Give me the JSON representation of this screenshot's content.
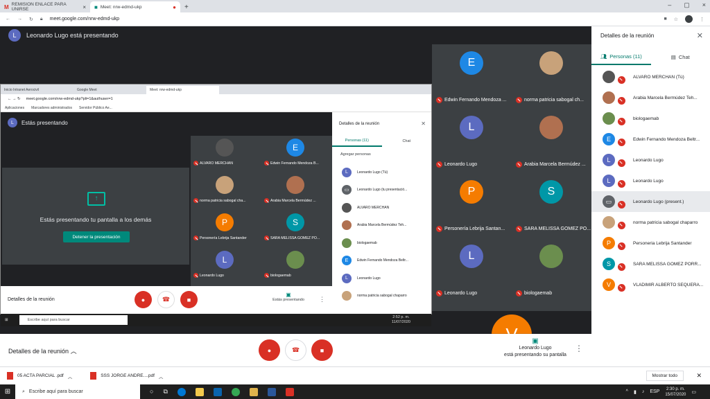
{
  "browser": {
    "tabs": [
      {
        "label": "REMISION ENLACE PARA UNIRSE",
        "active": false,
        "icon": "gmail-icon"
      },
      {
        "label": "Meet: nrw-edmd-ukp",
        "active": true,
        "icon": "meet-icon"
      }
    ],
    "url": "meet.google.com/nrw-edmd-ukp"
  },
  "meet": {
    "presenter_text": "Leonardo Lugo está presentando",
    "presenter_initial": "L",
    "grid": [
      {
        "name": "Edwin Fernando Mendoza ...",
        "initial": "E",
        "color": "#1e88e5",
        "photo": false
      },
      {
        "name": "norma patricia sabogal ch...",
        "initial": "",
        "color": "#c8a27a",
        "photo": true
      },
      {
        "name": "Leonardo Lugo",
        "initial": "L",
        "color": "#5c6bc0",
        "photo": false
      },
      {
        "name": "Arabia Marcela Bermúdez ...",
        "initial": "",
        "color": "#b07050",
        "photo": true
      },
      {
        "name": "Personería Lebrija Santan...",
        "initial": "P",
        "color": "#f57c00",
        "photo": false
      },
      {
        "name": "SARA MELISSA GOMEZ PO...",
        "initial": "S",
        "color": "#0097a7",
        "photo": false
      },
      {
        "name": "Leonardo Lugo",
        "initial": "L",
        "color": "#5c6bc0",
        "photo": false
      },
      {
        "name": "biologaemab",
        "initial": "",
        "color": "#6b8e4e",
        "photo": true
      }
    ],
    "partial_initial": "V",
    "bottom": {
      "details": "Detalles de la reunión",
      "presenting_name": "Leonardo Lugo",
      "presenting_text": "está presentando su pantalla"
    }
  },
  "share": {
    "tabs": [
      "Inicio Intranet Aerocivil",
      "Google Meet",
      "Meet: nrw-edmd-ukp"
    ],
    "url": "meet.google.com/nrw-edmd-ukp?pli=1&authuser=1",
    "bookmarks": [
      "Aplicaciones",
      "Marcadores administrados",
      "Servidor Público Ae..."
    ],
    "presenting_self": "Estás presentando",
    "presenting_msg": "Estás presentando tu pantalla a los demás",
    "stop_button": "Detener la presentación",
    "grid": [
      {
        "name": "ALVARO MERCHAN",
        "initial": "",
        "color": "#555",
        "photo": true
      },
      {
        "name": "Edwin Fernando Mendoza B...",
        "initial": "E",
        "color": "#1e88e5",
        "photo": false
      },
      {
        "name": "norma patricia sabogal cha...",
        "initial": "",
        "color": "#c8a27a",
        "photo": true
      },
      {
        "name": "Arabia Marcela Bermúdez ...",
        "initial": "",
        "color": "#b07050",
        "photo": true
      },
      {
        "name": "Personería Lebrija Santander",
        "initial": "P",
        "color": "#f57c00",
        "photo": false
      },
      {
        "name": "SARA MELISSA GOMEZ PO...",
        "initial": "S",
        "color": "#0097a7",
        "photo": false
      },
      {
        "name": "Leonardo Lugo",
        "initial": "L",
        "color": "#5c6bc0",
        "photo": false
      },
      {
        "name": "biologaemab",
        "initial": "",
        "color": "#6b8e4e",
        "photo": true
      }
    ],
    "panel": {
      "title": "Detalles de la reunión",
      "people_tab": "Personas (11)",
      "chat_tab": "Chat",
      "add_people": "Agregar personas",
      "people": [
        {
          "name": "Leonardo Lugo (Tú)",
          "initial": "L",
          "color": "#5c6bc0"
        },
        {
          "name": "Leonardo Lugo (tu presentació...",
          "initial": "▭",
          "color": "#5f6368"
        },
        {
          "name": "ALVARO MERCHAN",
          "initial": "",
          "color": "#555"
        },
        {
          "name": "Arabia Marcela Bermúdez Teh...",
          "initial": "",
          "color": "#b07050"
        },
        {
          "name": "biologaemab",
          "initial": "",
          "color": "#6b8e4e"
        },
        {
          "name": "Edwin Fernando Mendoza Beltr...",
          "initial": "E",
          "color": "#1e88e5"
        },
        {
          "name": "Leonardo Lugo",
          "initial": "L",
          "color": "#5c6bc0"
        },
        {
          "name": "norma patricia sabogal chaparro",
          "initial": "",
          "color": "#c8a27a"
        }
      ]
    },
    "bottom": {
      "details": "Detalles de la reunión",
      "presenting": "Estás presentando"
    },
    "taskbar": {
      "search": "Escribe aquí para buscar",
      "time": "2:52 p. m.",
      "date": "11/07/2020"
    }
  },
  "panel": {
    "title": "Detalles de la reunión",
    "people_tab": "Personas (11)",
    "chat_tab": "Chat",
    "people": [
      {
        "name": "ALVARO MERCHAN (Tú)",
        "initial": "",
        "color": "#555"
      },
      {
        "name": "Arabia Marcela Bermúdez Teh...",
        "initial": "",
        "color": "#b07050"
      },
      {
        "name": "biologaemab",
        "initial": "",
        "color": "#6b8e4e"
      },
      {
        "name": "Edwin Fernando Mendoza Beltr...",
        "initial": "E",
        "color": "#1e88e5"
      },
      {
        "name": "Leonardo Lugo",
        "initial": "L",
        "color": "#5c6bc0"
      },
      {
        "name": "Leonardo Lugo",
        "initial": "L",
        "color": "#5c6bc0"
      },
      {
        "name": "Leonardo Lugo (present.)",
        "initial": "▭",
        "color": "#5f6368"
      },
      {
        "name": "norma patricia sabogal chaparro",
        "initial": "",
        "color": "#c8a27a"
      },
      {
        "name": "Personeria Lebrija Santander",
        "initial": "P",
        "color": "#f57c00"
      },
      {
        "name": "SARA MELISSA GOMEZ PORR...",
        "initial": "S",
        "color": "#0097a7"
      },
      {
        "name": "VLADIMIR ALBERTO SEQUERA...",
        "initial": "V",
        "color": "#f57c00"
      }
    ]
  },
  "downloads": {
    "items": [
      "05 ACTA PARCIAL .pdf",
      "SSS JORGE ANDRE....pdf"
    ],
    "show_all": "Mostrar todo"
  },
  "taskbar": {
    "search": "Escribe aquí para buscar",
    "time": "2:30 p. m.",
    "date": "15/07/2020",
    "lang": "ESP"
  }
}
